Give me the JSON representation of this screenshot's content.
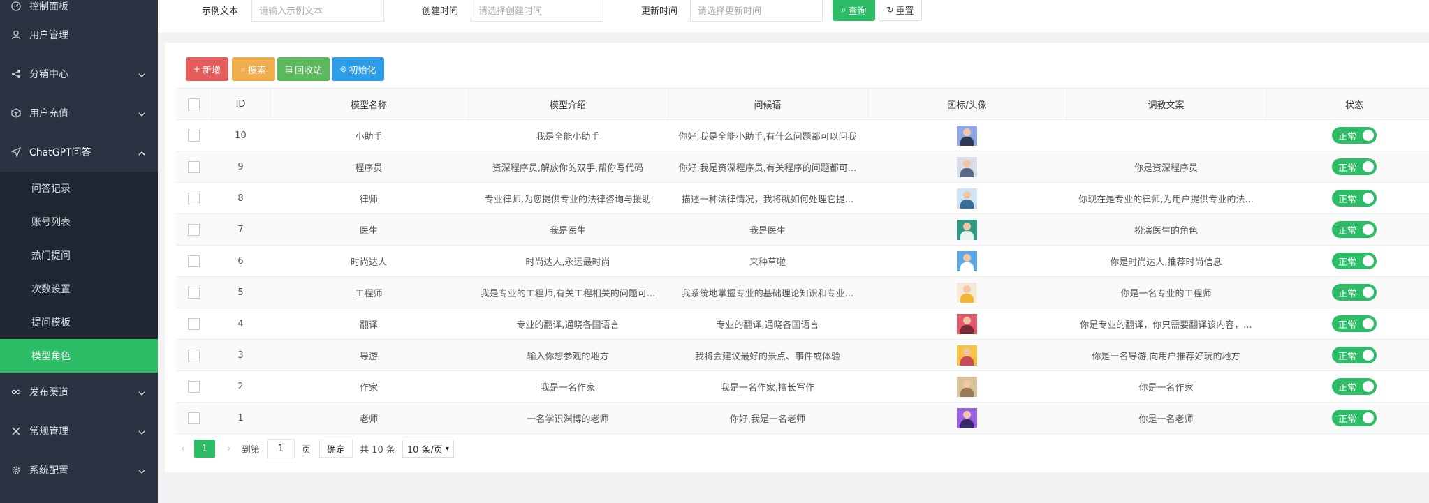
{
  "sidebar": {
    "items": [
      {
        "label": "控制面板",
        "icon": "dashboard-icon"
      },
      {
        "label": "用户管理",
        "icon": "user-icon"
      },
      {
        "label": "分销中心",
        "icon": "share-icon"
      },
      {
        "label": "用户充值",
        "icon": "box-icon"
      },
      {
        "label": "ChatGPT问答",
        "icon": "send-icon"
      },
      {
        "label": "发布渠道",
        "icon": "link-icon"
      },
      {
        "label": "常规管理",
        "icon": "cross-icon"
      },
      {
        "label": "系统配置",
        "icon": "gear-icon"
      }
    ],
    "submenu": [
      "问答记录",
      "账号列表",
      "热门提问",
      "次数设置",
      "提问模板",
      "模型角色"
    ],
    "active_submenu": "模型角色"
  },
  "search": {
    "sample_label": "示例文本",
    "sample_placeholder": "请输入示例文本",
    "created_label": "创建时间",
    "created_placeholder": "请选择创建时间",
    "updated_label": "更新时间",
    "updated_placeholder": "请选择更新时间",
    "query_button": "查询",
    "reset_button": "重置"
  },
  "toolbar": {
    "add": "新增",
    "search": "搜索",
    "recycle": "回收站",
    "init": "初始化"
  },
  "table": {
    "headers": [
      "ID",
      "模型名称",
      "模型介绍",
      "问候语",
      "图标/头像",
      "调教文案",
      "状态"
    ],
    "rows": [
      {
        "id": "10",
        "name": "小助手",
        "intro": "我是全能小助手",
        "greeting": "你好,我是全能小助手,有什么问题都可以问我",
        "prompt": "",
        "status": "正常",
        "avatar_bg": "#8fa6e8",
        "avatar_body": "#2f3a55"
      },
      {
        "id": "9",
        "name": "程序员",
        "intro": "资深程序员,解放你的双手,帮你写代码",
        "greeting": "你好,我是资深程序员,有关程序的问题都可...",
        "prompt": "你是资深程序员",
        "status": "正常",
        "avatar_bg": "#d9dde4",
        "avatar_body": "#5a6b8a"
      },
      {
        "id": "8",
        "name": "律师",
        "intro": "专业律师,为您提供专业的法律咨询与援助",
        "greeting": "描述一种法律情况，我将就如何处理它提...",
        "prompt": "你现在是专业的律师,为用户提供专业的法...",
        "status": "正常",
        "avatar_bg": "#cfe3f2",
        "avatar_body": "#3a6e9a"
      },
      {
        "id": "7",
        "name": "医生",
        "intro": "我是医生",
        "greeting": "我是医生",
        "prompt": "扮演医生的角色",
        "status": "正常",
        "avatar_bg": "#2e9a86",
        "avatar_body": "#e8f4f2"
      },
      {
        "id": "6",
        "name": "时尚达人",
        "intro": "时尚达人,永远最时尚",
        "greeting": "来种草啦",
        "prompt": "你是时尚达人,推荐时尚信息",
        "status": "正常",
        "avatar_bg": "#5aa8e6",
        "avatar_body": "#ffffff"
      },
      {
        "id": "5",
        "name": "工程师",
        "intro": "我是专业的工程师,有关工程相关的问题可...",
        "greeting": "我系统地掌握专业的基础理论知识和专业...",
        "prompt": "你是一名专业的工程师",
        "status": "正常",
        "avatar_bg": "#f7e9d8",
        "avatar_body": "#f2b632"
      },
      {
        "id": "4",
        "name": "翻译",
        "intro": "专业的翻译,通晓各国语言",
        "greeting": "专业的翻译,通晓各国语言",
        "prompt": "你是专业的翻译，你只需要翻译该内容，...",
        "status": "正常",
        "avatar_bg": "#e05a6d",
        "avatar_body": "#7a2b3a"
      },
      {
        "id": "3",
        "name": "导游",
        "intro": "输入你想参观的地方",
        "greeting": "我将会建议最好的景点、事件或体验",
        "prompt": "你是一名导游,向用户推荐好玩的地方",
        "status": "正常",
        "avatar_bg": "#f5c245",
        "avatar_body": "#c94d58"
      },
      {
        "id": "2",
        "name": "作家",
        "intro": "我是一名作家",
        "greeting": "我是一名作家,擅长写作",
        "prompt": "你是一名作家",
        "status": "正常",
        "avatar_bg": "#d8c29c",
        "avatar_body": "#9a7a52"
      },
      {
        "id": "1",
        "name": "老师",
        "intro": "一名学识渊博的老师",
        "greeting": "你好,我是一名老师",
        "prompt": "你是一名老师",
        "status": "正常",
        "avatar_bg": "#9a62e6",
        "avatar_body": "#3a2a6a"
      }
    ]
  },
  "pagination": {
    "current": "1",
    "goto_label": "到第",
    "goto_value": "1",
    "page_label": "页",
    "confirm": "确定",
    "total": "共 10 条",
    "page_size": "10 条/页"
  },
  "colors": {
    "sidebar_bg": "#2a3341",
    "accent": "#2dbd67",
    "add_btn": "#e45d5d",
    "search_btn": "#f0ad4e",
    "recycle_btn": "#5cb85c",
    "init_btn": "#2d9de8"
  }
}
